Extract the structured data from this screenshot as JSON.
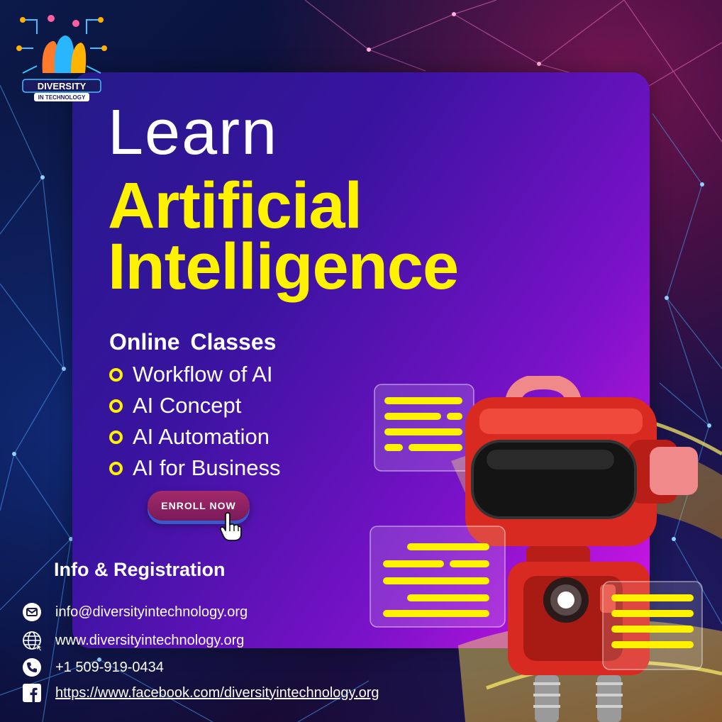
{
  "brand": {
    "logo_text_main": "DIVERSITY",
    "logo_text_sub": "IN TECHNOLOGY"
  },
  "headline": {
    "line1": "Learn",
    "line2": "Artificial",
    "line3": "Intelligence"
  },
  "classes": {
    "heading": "Online  Classes",
    "items": [
      "Workflow of AI",
      "AI Concept",
      "AI Automation",
      "AI for Business"
    ]
  },
  "cta": {
    "label": "ENROLL NOW"
  },
  "info": {
    "heading": "Info & Registration",
    "email": "info@diversityintechnology.org",
    "website": "www.diversityintechnology.org",
    "phone": "+1 509-919-0434",
    "facebook": "https://www.facebook.com/diversityintechnology.org"
  },
  "icons": [
    "mail-icon",
    "globe-icon",
    "phone-icon",
    "facebook-icon",
    "pointer-hand-icon",
    "robot-illustration"
  ],
  "colors": {
    "accent_yellow": "#fff200",
    "card_start": "#251a8a",
    "card_end": "#d515e6",
    "button": "#8a1f60",
    "robot_red": "#e0322a"
  }
}
